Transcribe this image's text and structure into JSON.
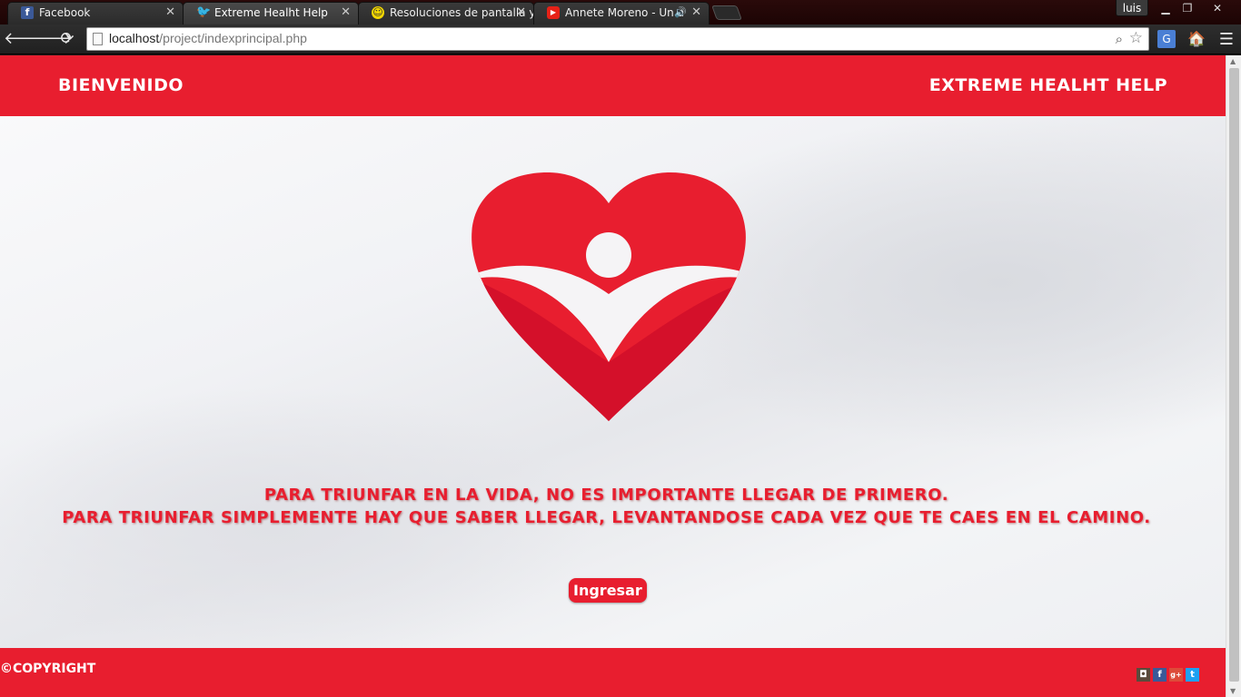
{
  "browser": {
    "tabs": [
      {
        "label": "Facebook",
        "icon": "facebook-icon",
        "color": "#3b5998",
        "active": false
      },
      {
        "label": "Extreme Healht Help",
        "icon": "twitter-icon",
        "color": "#1da1f2",
        "active": true
      },
      {
        "label": "Resoluciones de pantalla y",
        "icon": "smiley-icon",
        "color": "#f2d600",
        "active": false
      },
      {
        "label": "Annete Moreno - Un a",
        "icon": "youtube-icon",
        "color": "#e62117",
        "active": false
      }
    ],
    "user": "luis",
    "url_host": "localhost",
    "url_path": "/project/indexprincipal.php"
  },
  "header": {
    "left": "BIENVENIDO",
    "right": "EXTREME HEALHT HELP"
  },
  "quote": {
    "line1": "PARA TRIUNFAR EN LA VIDA, NO ES IMPORTANTE LLEGAR DE PRIMERO.",
    "line2": "PARA TRIUNFAR SIMPLEMENTE HAY QUE SABER LLEGAR, LEVANTANDOSE CADA VEZ QUE TE CAES EN EL CAMINO."
  },
  "cta": {
    "label": "Ingresar"
  },
  "footer": {
    "copyright": "©COPYRIGHT",
    "social": [
      "instagram-icon",
      "facebook-icon",
      "google-plus-icon",
      "twitter-icon"
    ]
  },
  "colors": {
    "brand": "#e81e2f",
    "brand_dark": "#d4102a"
  }
}
